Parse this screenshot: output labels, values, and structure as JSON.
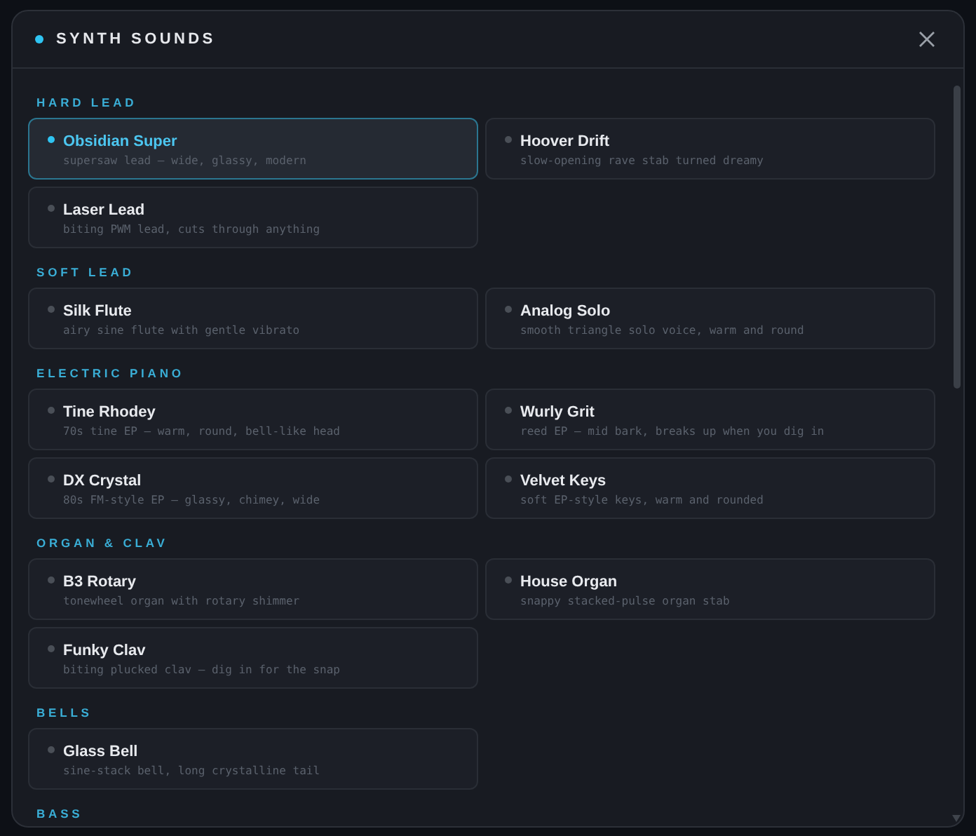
{
  "dialog": {
    "title": "SYNTH SOUNDS"
  },
  "sections": [
    {
      "label": "HARD LEAD",
      "presets": [
        {
          "name": "Obsidian Super",
          "description": "supersaw lead — wide, glassy, modern",
          "selected": true
        },
        {
          "name": "Hoover Drift",
          "description": "slow-opening rave stab turned dreamy",
          "selected": false
        },
        {
          "name": "Laser Lead",
          "description": "biting PWM lead, cuts through anything",
          "selected": false
        }
      ]
    },
    {
      "label": "SOFT LEAD",
      "presets": [
        {
          "name": "Silk Flute",
          "description": "airy sine flute with gentle vibrato",
          "selected": false
        },
        {
          "name": "Analog Solo",
          "description": "smooth triangle solo voice, warm and round",
          "selected": false
        }
      ]
    },
    {
      "label": "ELECTRIC PIANO",
      "presets": [
        {
          "name": "Tine Rhodey",
          "description": "70s tine EP — warm, round, bell-like head",
          "selected": false
        },
        {
          "name": "Wurly Grit",
          "description": "reed EP — mid bark, breaks up when you dig in",
          "selected": false
        },
        {
          "name": "DX Crystal",
          "description": "80s FM-style EP — glassy, chimey, wide",
          "selected": false
        },
        {
          "name": "Velvet Keys",
          "description": "soft EP-style keys, warm and rounded",
          "selected": false
        }
      ]
    },
    {
      "label": "ORGAN & CLAV",
      "presets": [
        {
          "name": "B3 Rotary",
          "description": "tonewheel organ with rotary shimmer",
          "selected": false
        },
        {
          "name": "House Organ",
          "description": "snappy stacked-pulse organ stab",
          "selected": false
        },
        {
          "name": "Funky Clav",
          "description": "biting plucked clav — dig in for the snap",
          "selected": false
        }
      ]
    },
    {
      "label": "BELLS",
      "presets": [
        {
          "name": "Glass Bell",
          "description": "sine-stack bell, long crystalline tail",
          "selected": false
        }
      ]
    },
    {
      "label": "BASS"
    }
  ]
}
